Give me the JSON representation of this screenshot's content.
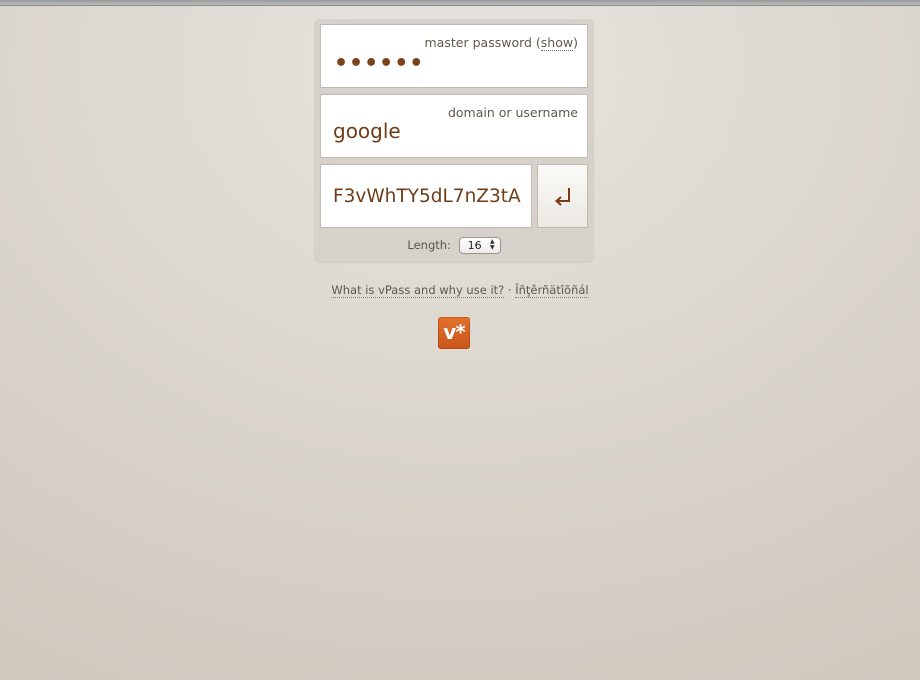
{
  "master_password": {
    "label_prefix": "master password (",
    "show_link": "show",
    "label_suffix": ")",
    "value_masked": "••••••"
  },
  "domain": {
    "label": "domain or username",
    "value": "google"
  },
  "result": {
    "generated_password": "F3vWhTY5dL7nZ3tA",
    "go_icon": "return-arrow-icon"
  },
  "length": {
    "label": "Length:",
    "selected": "16"
  },
  "footer": {
    "about_link": "What is vPass and why use it?",
    "separator": " · ",
    "international_link": "Îñţêrñätîõñál"
  },
  "logo": {
    "text": "v*"
  },
  "colors": {
    "accent": "#cf5d1f",
    "value_text": "#6f3d19"
  }
}
